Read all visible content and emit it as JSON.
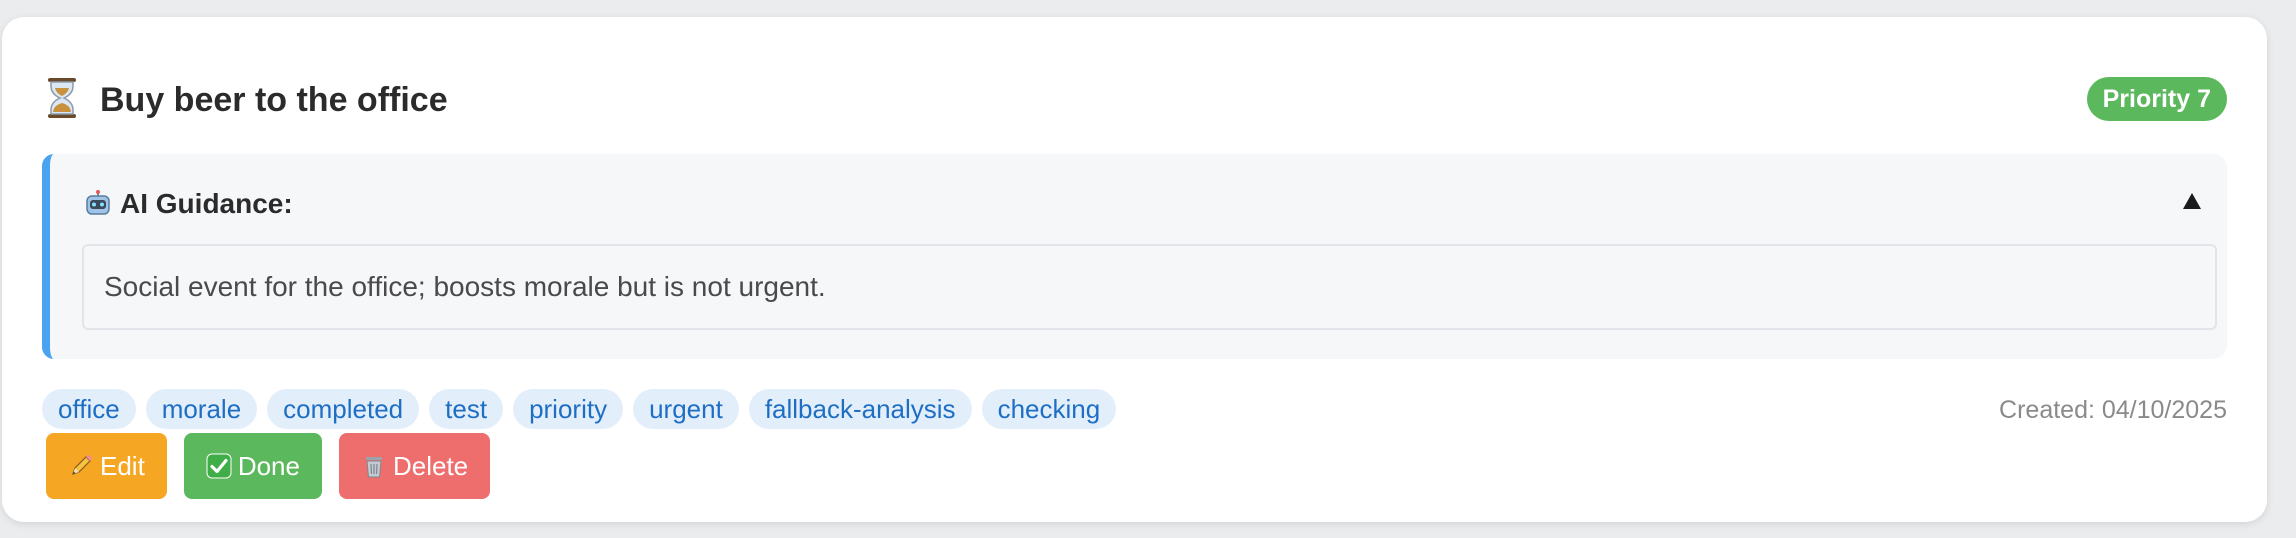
{
  "task": {
    "title": "Buy beer to the office",
    "status_icon": "hourglass-icon",
    "priority_label": "Priority 7",
    "created_label": "Created: 04/10/2025"
  },
  "guidance": {
    "title": "AI Guidance:",
    "icon": "robot-icon",
    "toggle": "▲",
    "text": "Social event for the office; boosts morale but is not urgent."
  },
  "tags": [
    "office",
    "morale",
    "completed",
    "test",
    "priority",
    "urgent",
    "fallback-analysis",
    "checking"
  ],
  "actions": {
    "edit_label": "Edit",
    "done_label": "Done",
    "delete_label": "Delete"
  },
  "colors": {
    "priority": "#5cb85c",
    "guidance_accent": "#4aa3f0",
    "tag_bg": "#e3eefb",
    "tag_text": "#1e6fc4",
    "edit": "#f5a623",
    "done": "#5cb85c",
    "delete": "#ee6e6e"
  }
}
